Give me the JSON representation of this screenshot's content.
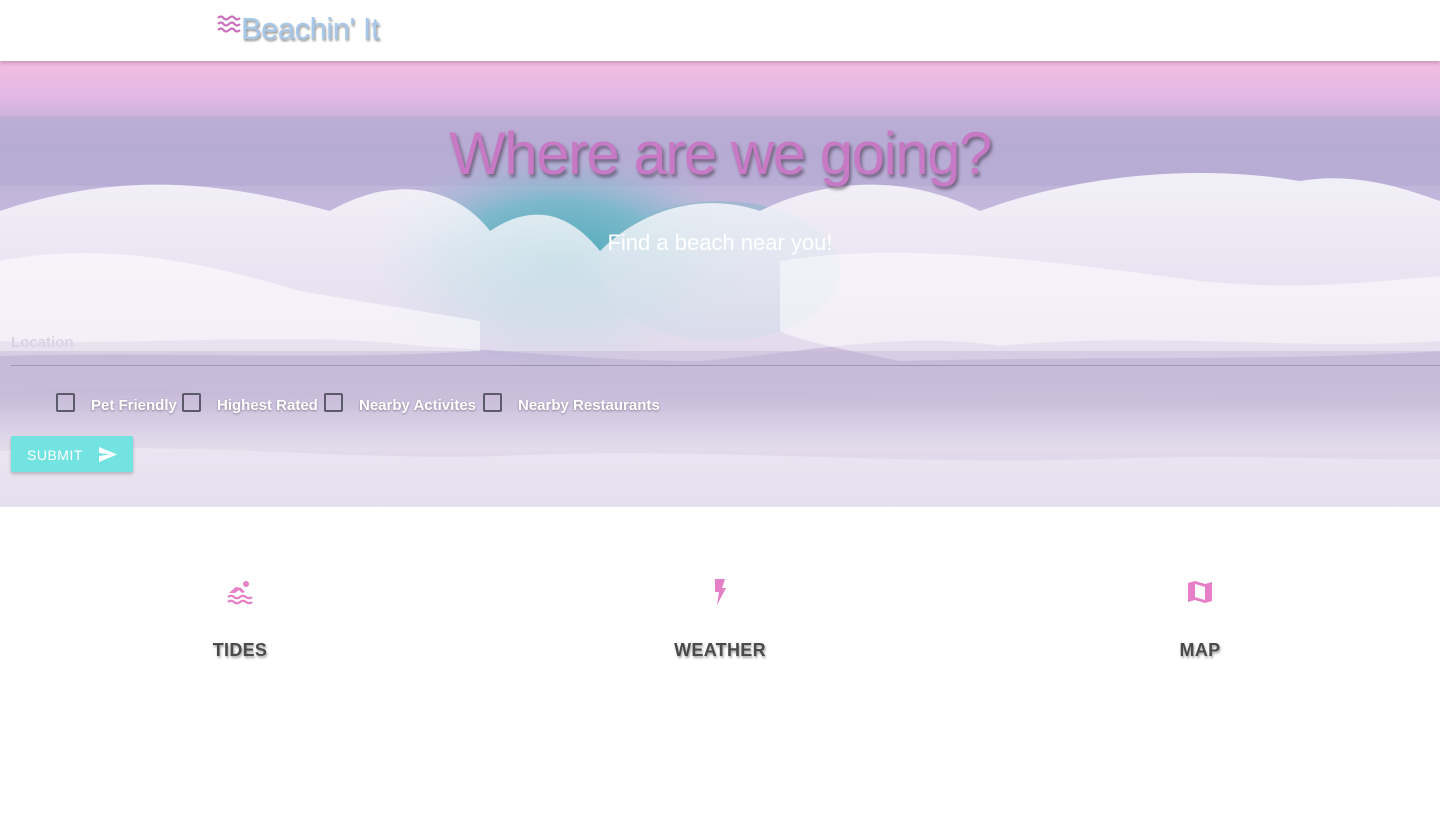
{
  "navbar": {
    "brand_text": "Beachin' It",
    "brand_icon": "waves-icon",
    "brand_color": "#a7c7e8"
  },
  "hero": {
    "title": "Where are we going?",
    "subtitle": "Find a beach near you!",
    "title_color": "#c879c5"
  },
  "search": {
    "location_label": "Location",
    "location_value": "",
    "filters": [
      {
        "label": "Pet Friendly",
        "checked": false
      },
      {
        "label": "Highest Rated",
        "checked": false
      },
      {
        "label": "Nearby Activites",
        "checked": false
      },
      {
        "label": "Nearby Restaurants",
        "checked": false
      }
    ],
    "submit_label": "SUBMIT",
    "submit_icon": "send-icon",
    "submit_color": "#72e3e0"
  },
  "features": [
    {
      "label": "TIDES",
      "icon": "swimmer-icon"
    },
    {
      "label": "WEATHER",
      "icon": "bolt-icon"
    },
    {
      "label": "MAP",
      "icon": "map-icon"
    }
  ],
  "accent_color": "#e57fc6"
}
